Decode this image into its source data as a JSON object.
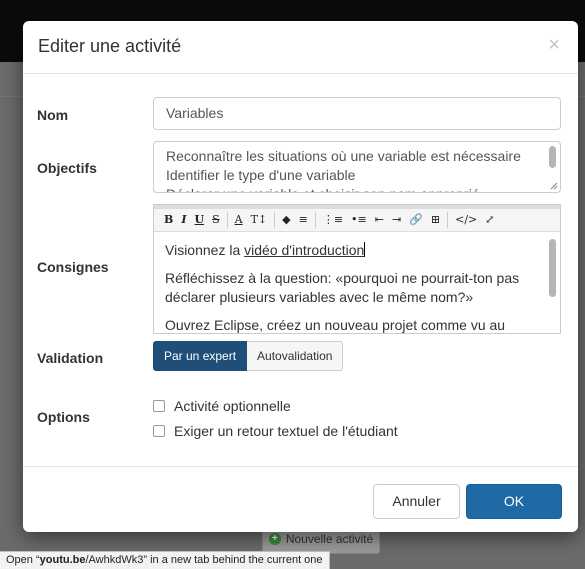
{
  "modal": {
    "title": "Editer une activité",
    "close_glyph": "×"
  },
  "form": {
    "name_label": "Nom",
    "name_value": "Variables",
    "objectives_label": "Objectifs",
    "objectives_lines": [
      "Reconnaître les situations où une variable est nécessaire",
      "Identifier le type d'une variable",
      "Déclarer une variable et choisir son nom approprié"
    ],
    "instructions_label": "Consignes",
    "instructions": {
      "p1_prefix": "Visionnez la ",
      "p1_link": "vidéo d'introduction",
      "p2": "Réfléchissez à la question: «pourquoi ne pourrait-ton pas déclarer plusieurs variables avec le même nom?»",
      "p3": "Ouvrez Eclipse, créez un nouveau projet comme vu au cours"
    },
    "toolbar": {
      "bold": "B",
      "italic": "I",
      "underline": "U",
      "strike": "S",
      "font_color": "A",
      "font_size": "T↕",
      "highlight": "◆",
      "align": "≡",
      "ordered_list": "⋮≡",
      "unordered_list": "•≡",
      "outdent": "⇤",
      "indent": "⇥",
      "link": "🔗",
      "table": "⊞",
      "code": "</>",
      "fullscreen": "⤢"
    },
    "validation_label": "Validation",
    "validation_options": [
      "Par un expert",
      "Autovalidation"
    ],
    "validation_selected": "Par un expert",
    "options_label": "Options",
    "option_optional": "Activité optionnelle",
    "option_text_feedback": "Exiger un retour textuel de l'étudiant"
  },
  "footer": {
    "cancel_label": "Annuler",
    "ok_label": "OK"
  },
  "background": {
    "new_activity_label": "Nouvelle activité"
  },
  "status_bar": {
    "prefix": "Open “",
    "host": "youtu.be",
    "path": "/AwhkdWk3",
    "suffix": "” in a new tab behind the current one"
  },
  "colors": {
    "primary": "#1f6aa5",
    "toggle_active": "#1f4e79"
  }
}
